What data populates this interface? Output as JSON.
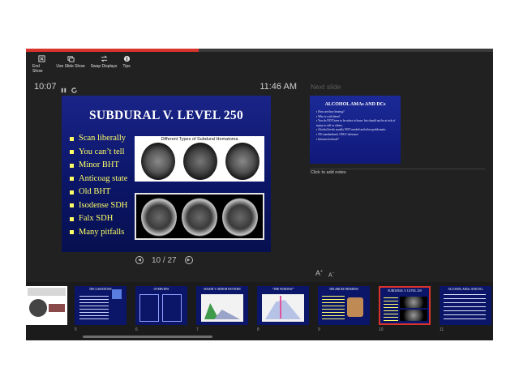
{
  "toolbar": {
    "end_show": "End Show",
    "use_slide_show": "Use Slide Show",
    "swap_displays": "Swap Displays",
    "tips": "Tips"
  },
  "progress": {
    "fraction": 0.37,
    "color": "#d9342b"
  },
  "timer": "10:07",
  "clock": "11:46 AM",
  "current_slide": {
    "title": "SUBDURAL V. LEVEL 250",
    "bullets": [
      "Scan liberally",
      "You can’t tell",
      "Minor BHT",
      "Anticoag state",
      "Old BHT",
      "Isodense SDH",
      "Falx SDH",
      "Many pitfalls"
    ],
    "image_caption": "Different Types of Subdural Hematoma"
  },
  "slide_nav": {
    "counter": "10 / 27"
  },
  "next_slide": {
    "label": "Next slide",
    "title": "ALCOHOL AMAs AND DCs",
    "bullets": [
      "How are they leaving?",
      "Who is with them?",
      "You do NOT have to be sober to leave, but should not be at risk of injury to self or others.",
      "Alcohol levels usually NOT needed and often problematic",
      "NO standardized, ONLY tolerance",
      "Informed refusal?"
    ]
  },
  "notes": {
    "placeholder": "Click to add notes"
  },
  "font_controls": {
    "increase": "A",
    "decrease": "A"
  },
  "thumbnails": [
    {
      "num": "",
      "title": ""
    },
    {
      "num": "5",
      "title": "DECLARATIONS"
    },
    {
      "num": "6",
      "title": "OVERVIEW"
    },
    {
      "num": "7",
      "title": "MAJOR V. MINOR PATTERN"
    },
    {
      "num": "8",
      "title": "“THE WINDOW”"
    },
    {
      "num": "9",
      "title": "DELIRIUM TREMENS"
    },
    {
      "num": "10",
      "title": "SUBDURAL V. LEVEL 250"
    },
    {
      "num": "11",
      "title": "ALCOHOL AMAs AND DCs"
    }
  ],
  "colors": {
    "app_bg": "#212121",
    "slide_blue": "#0b1668",
    "bullet_yellow": "#ffff66",
    "active_border": "#d9342b"
  }
}
